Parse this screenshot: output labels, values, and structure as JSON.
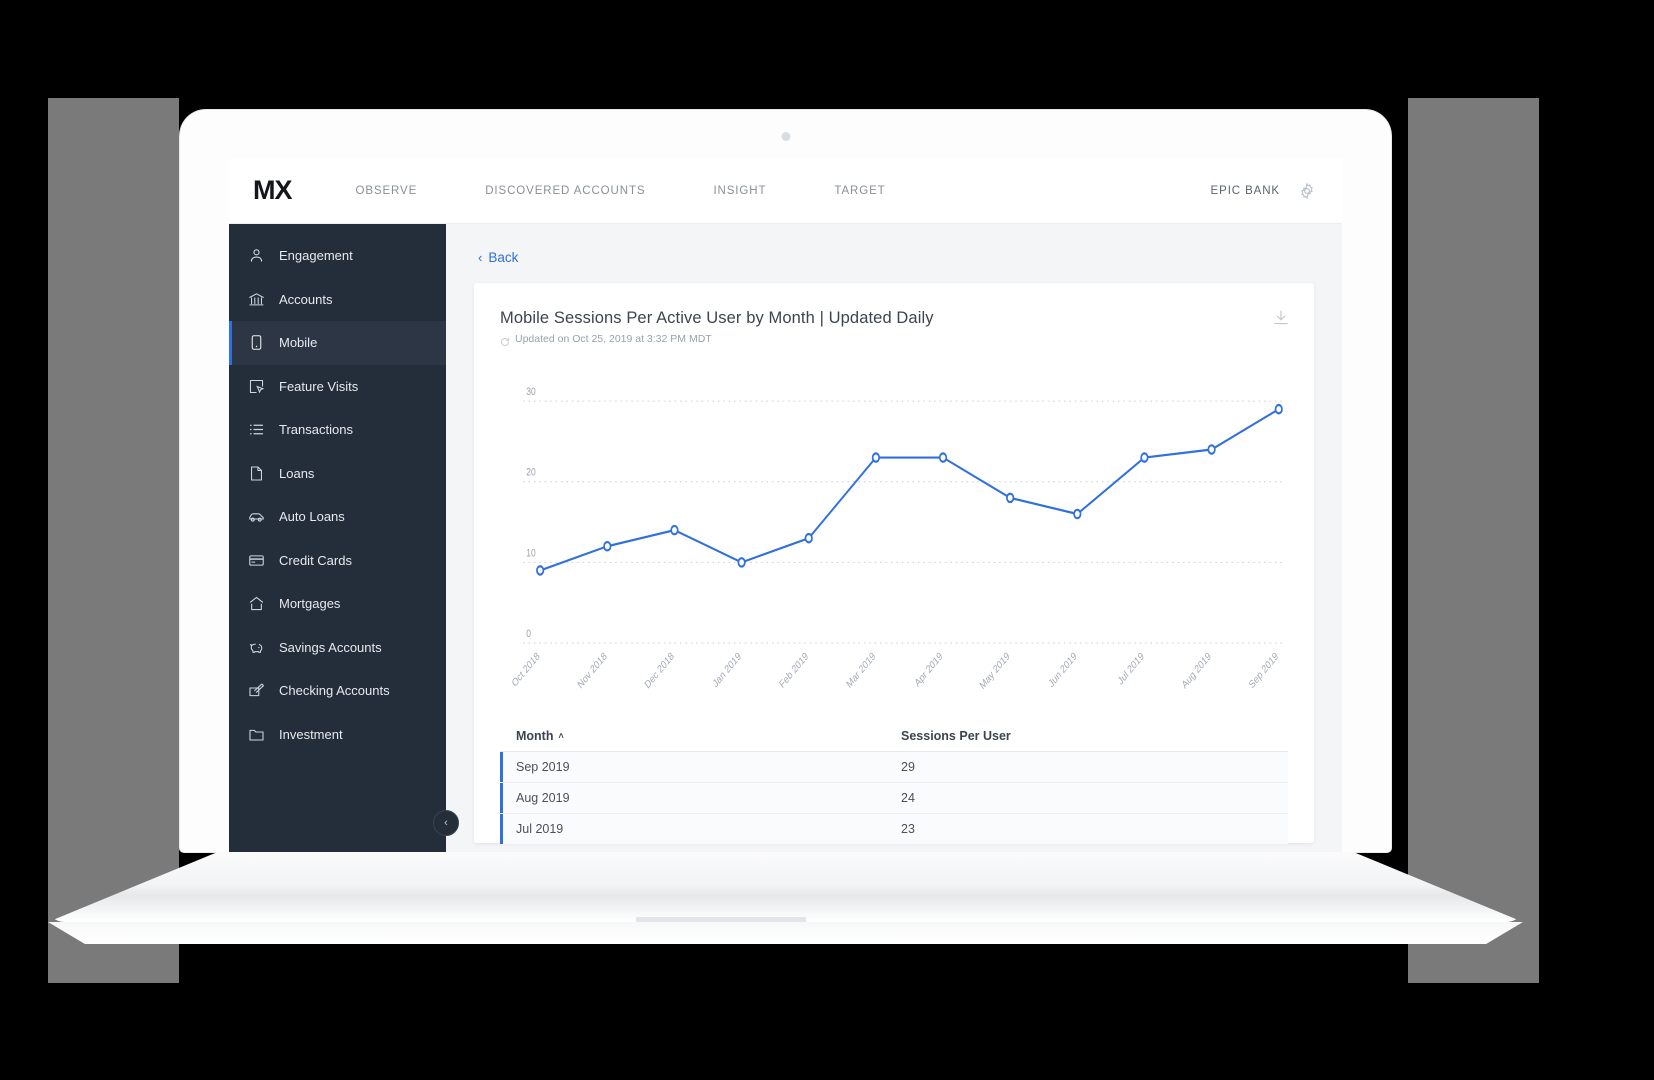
{
  "topnav": {
    "logo": "MX",
    "links": [
      {
        "label": "OBSERVE",
        "name": "nav-observe"
      },
      {
        "label": "DISCOVERED ACCOUNTS",
        "name": "nav-discovered-accounts"
      },
      {
        "label": "INSIGHT",
        "name": "nav-insight"
      },
      {
        "label": "TARGET",
        "name": "nav-target"
      }
    ],
    "bank": "EPIC BANK",
    "gear_icon": "gear-icon"
  },
  "sidebar": {
    "items": [
      {
        "label": "Engagement",
        "icon": "person-icon",
        "active": false
      },
      {
        "label": "Accounts",
        "icon": "bank-icon",
        "active": false
      },
      {
        "label": "Mobile",
        "icon": "mobile-phone-icon",
        "active": true
      },
      {
        "label": "Feature Visits",
        "icon": "cursor-click-icon",
        "active": false
      },
      {
        "label": "Transactions",
        "icon": "list-icon",
        "active": false
      },
      {
        "label": "Loans",
        "icon": "document-icon",
        "active": false
      },
      {
        "label": "Auto Loans",
        "icon": "car-icon",
        "active": false
      },
      {
        "label": "Credit Cards",
        "icon": "credit-card-icon",
        "active": false
      },
      {
        "label": "Mortgages",
        "icon": "house-icon",
        "active": false
      },
      {
        "label": "Savings Accounts",
        "icon": "piggy-bank-icon",
        "active": false
      },
      {
        "label": "Checking Accounts",
        "icon": "checkbook-pen-icon",
        "active": false
      },
      {
        "label": "Investment",
        "icon": "folder-icon",
        "active": false
      }
    ],
    "collapse_label": "‹"
  },
  "main": {
    "back_label": "Back",
    "back_chevron": "‹",
    "card_title": "Mobile Sessions Per Active User by Month | Updated Daily",
    "card_subtitle": "Updated on Oct 25, 2019 at 3:32 PM MDT",
    "download_icon": "download-icon",
    "refresh_icon": "refresh-icon"
  },
  "table": {
    "columns": [
      "Month",
      "Sessions Per User"
    ],
    "sort_column": "Month",
    "sort_direction": "ascending",
    "sort_caret": "˄",
    "rows": [
      {
        "month": "Sep 2019",
        "sessions": "29"
      },
      {
        "month": "Aug 2019",
        "sessions": "24"
      },
      {
        "month": "Jul 2019",
        "sessions": "23"
      }
    ]
  },
  "colors": {
    "accent": "#2f6fde",
    "sidebar_bg": "#242d3a",
    "sidebar_active": "#2c3644",
    "page_bg": "#f4f5f7",
    "line": "#2f6fde"
  },
  "chart_data": {
    "type": "line",
    "title": "Mobile Sessions Per Active User by Month | Updated Daily",
    "subtitle": "Updated on Oct 25, 2019 at 3:32 PM MDT",
    "xlabel": "",
    "ylabel": "",
    "categories": [
      "Oct 2018",
      "Nov 2018",
      "Dec 2018",
      "Jan 2019",
      "Feb 2019",
      "Mar 2019",
      "Apr 2019",
      "May 2019",
      "Jun 2019",
      "Jul 2019",
      "Aug 2019",
      "Sep 2019"
    ],
    "values": [
      9,
      12,
      14,
      10,
      13,
      23,
      23,
      18,
      16,
      23,
      24,
      29
    ],
    "ylim": [
      0,
      32
    ],
    "yticks": [
      0,
      10,
      20,
      30
    ],
    "grid": true,
    "legend": "none",
    "series": [
      {
        "name": "Sessions Per User",
        "color": "#2f6fde",
        "values": [
          9,
          12,
          14,
          10,
          13,
          23,
          23,
          18,
          16,
          23,
          24,
          29
        ]
      }
    ]
  }
}
